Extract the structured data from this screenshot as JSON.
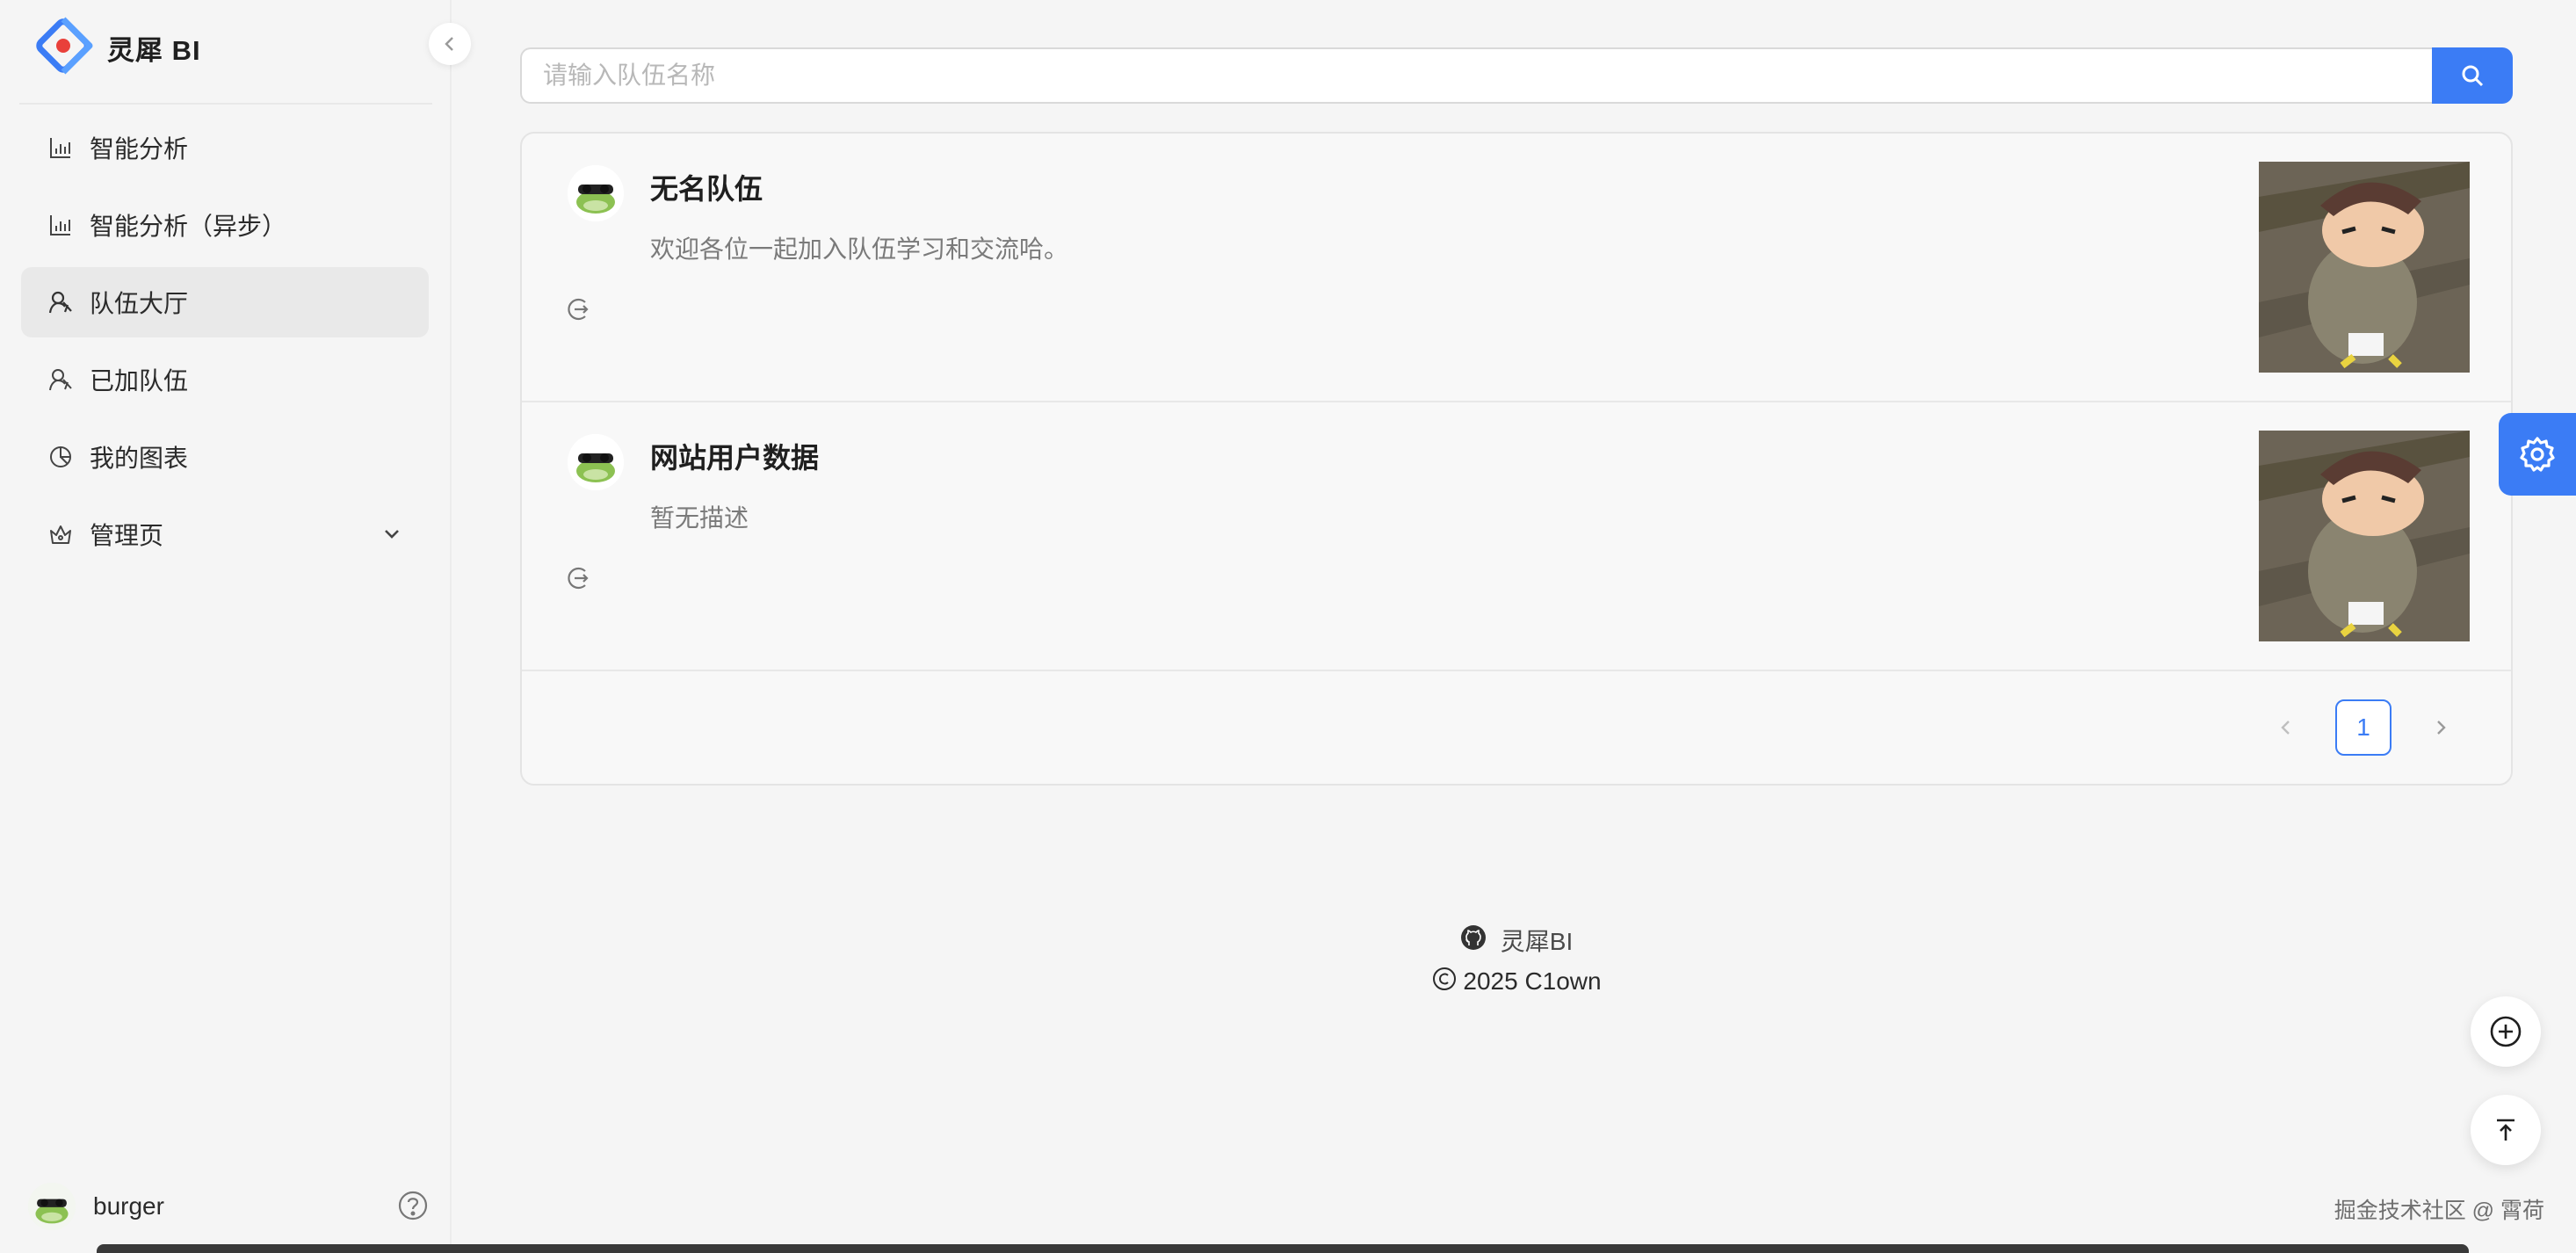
{
  "brand": {
    "title": "灵犀 BI"
  },
  "sidebar": {
    "items": [
      {
        "label": "智能分析",
        "icon": "bar-chart-icon"
      },
      {
        "label": "智能分析（异步）",
        "icon": "bar-chart-icon"
      },
      {
        "label": "队伍大厅",
        "icon": "team-icon",
        "active": true
      },
      {
        "label": "已加队伍",
        "icon": "team-icon"
      },
      {
        "label": "我的图表",
        "icon": "pie-chart-icon"
      },
      {
        "label": "管理页",
        "icon": "crown-icon",
        "expandable": true
      }
    ],
    "user": {
      "name": "burger"
    }
  },
  "search": {
    "placeholder": "请输入队伍名称",
    "value": ""
  },
  "teams": [
    {
      "name": "无名队伍",
      "description": "欢迎各位一起加入队伍学习和交流哈。"
    },
    {
      "name": "网站用户数据",
      "description": "暂无描述"
    }
  ],
  "pagination": {
    "current": "1"
  },
  "footer": {
    "project": "灵犀BI",
    "copyright": "2025 C1own"
  },
  "watermark": "掘金技术社区 @ 霄荷",
  "colors": {
    "primary": "#3b7cf5",
    "sidebar_active": "#e9e9e9"
  }
}
